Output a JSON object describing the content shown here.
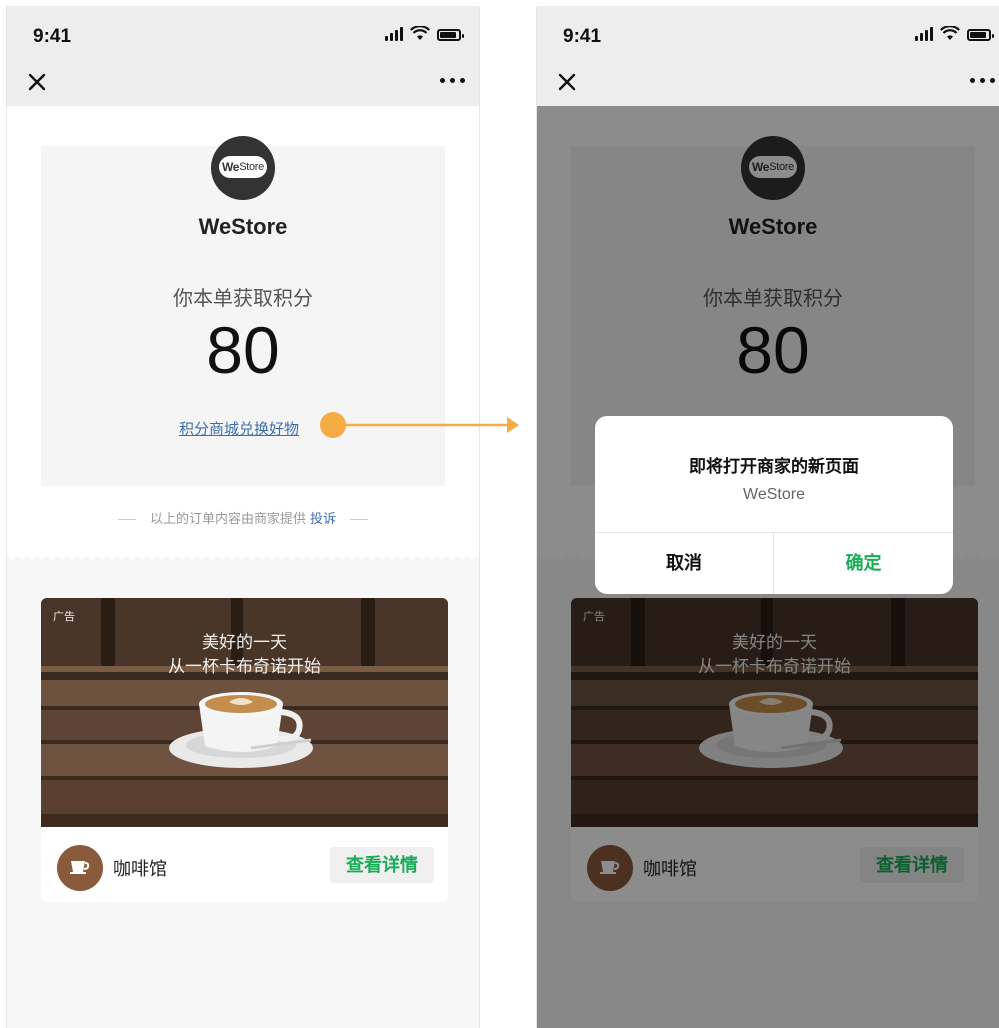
{
  "status_bar": {
    "time": "9:41"
  },
  "nav": {
    "close_icon": "close-icon",
    "more_icon": "more-icon"
  },
  "merchant": {
    "logo_text_bold": "We",
    "logo_text_light": "Store",
    "name": "WeStore"
  },
  "points": {
    "label": "你本单获取积分",
    "value": "80",
    "link": "积分商城兑换好物"
  },
  "footnote": {
    "text": "以上的订单内容由商家提供",
    "report": "投诉"
  },
  "ad": {
    "tag": "广告",
    "headline_1": "美好的一天",
    "headline_2": "从一杯卡布奇诺开始",
    "shop_name": "咖啡馆",
    "detail_button": "查看详情"
  },
  "dialog": {
    "title": "即将打开商家的新页面",
    "subtitle": "WeStore",
    "cancel": "取消",
    "confirm": "确定"
  },
  "colors": {
    "accent_green": "#1aad58",
    "link_blue": "#3d6fb0",
    "annotation_orange": "#f5ac45",
    "overlay": "rgba(0,0,0,0.45)"
  }
}
